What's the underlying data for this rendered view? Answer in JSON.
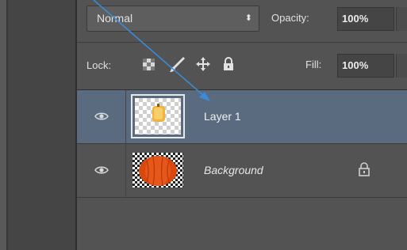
{
  "blend_mode": {
    "value": "Normal"
  },
  "opacity": {
    "label": "Opacity:",
    "value": "100%"
  },
  "lock": {
    "label": "Lock:"
  },
  "fill": {
    "label": "Fill:",
    "value": "100%"
  },
  "layers": [
    {
      "name": "Layer 1",
      "selected": true,
      "visible": true,
      "icon": "pumpkin-thumbnail"
    },
    {
      "name": "Background",
      "selected": false,
      "visible": true,
      "locked": true,
      "icon": "pumpkin-thumbnail"
    }
  ],
  "colors": {
    "selected_row": "#5a6b80",
    "panel_bg": "#535353",
    "annotation_arrow": "#3b8ad6"
  }
}
